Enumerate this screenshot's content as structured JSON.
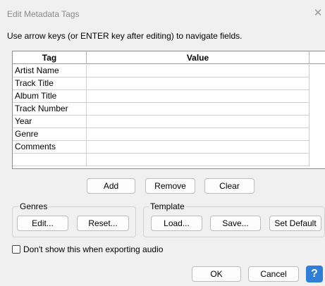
{
  "window": {
    "title": "Edit Metadata Tags",
    "close_glyph": "✕",
    "instruction": "Use arrow keys (or ENTER key after editing) to navigate fields."
  },
  "table": {
    "columns": [
      "Tag",
      "Value"
    ],
    "rows": [
      {
        "tag": "Artist Name",
        "value": ""
      },
      {
        "tag": "Track Title",
        "value": ""
      },
      {
        "tag": "Album Title",
        "value": ""
      },
      {
        "tag": "Track Number",
        "value": ""
      },
      {
        "tag": "Year",
        "value": ""
      },
      {
        "tag": "Genre",
        "value": ""
      },
      {
        "tag": "Comments",
        "value": ""
      },
      {
        "tag": "",
        "value": ""
      }
    ]
  },
  "table_buttons": {
    "add": "Add",
    "remove": "Remove",
    "clear": "Clear"
  },
  "genres": {
    "label": "Genres",
    "edit": "Edit...",
    "reset": "Reset..."
  },
  "template": {
    "label": "Template",
    "load": "Load...",
    "save": "Save...",
    "set_default": "Set Default"
  },
  "options": {
    "dont_show_label": "Don't show this when exporting audio",
    "dont_show_checked": false
  },
  "footer": {
    "ok": "OK",
    "cancel": "Cancel",
    "help_glyph": "?"
  },
  "colors": {
    "background": "#f0f0f0",
    "help_button": "#2f7fd8"
  }
}
